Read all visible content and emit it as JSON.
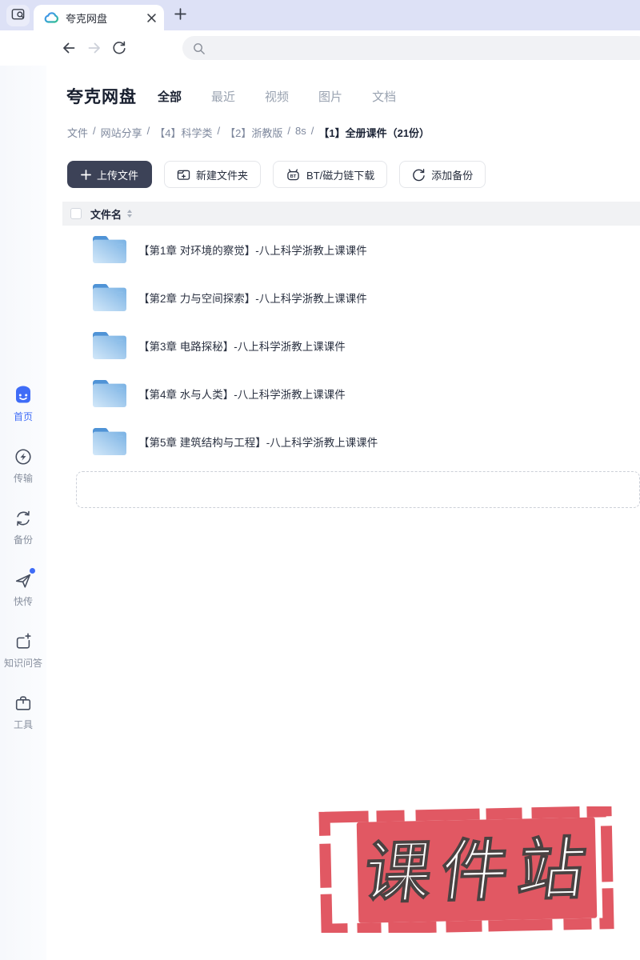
{
  "browser": {
    "tab_title": "夸克网盘",
    "icons": {
      "tab_search": "window-search-icon",
      "logo": "quark-cloud-logo-icon",
      "close": "close-icon",
      "new_tab": "plus-icon",
      "back": "arrow-left-icon",
      "forward": "arrow-right-icon",
      "refresh": "refresh-icon",
      "address_search": "search-icon"
    }
  },
  "header": {
    "app_title": "夸克网盘",
    "tabs": [
      {
        "label": "全部",
        "active": true
      },
      {
        "label": "最近",
        "active": false
      },
      {
        "label": "视频",
        "active": false
      },
      {
        "label": "图片",
        "active": false
      },
      {
        "label": "文档",
        "active": false
      }
    ]
  },
  "breadcrumb": {
    "separator": "/",
    "parts": [
      "文件",
      "网站分享",
      "【4】科学类",
      "【2】浙教版",
      "8s"
    ],
    "current": "【1】全册课件（21份）"
  },
  "toolbar": {
    "upload": "上传文件",
    "new_folder": "新建文件夹",
    "bt_download": "BT/磁力链下载",
    "add_backup": "添加备份",
    "icons": {
      "upload": "plus-icon",
      "new_folder": "folder-plus-icon",
      "bt_download": "bt-robot-icon",
      "add_backup": "sync-icon"
    }
  },
  "table": {
    "name_header": "文件名",
    "sort_icon": "sort-arrows-icon"
  },
  "files": [
    {
      "name": "【第1章 对环境的察觉】-八上科学浙教上课课件",
      "icon": "folder-icon"
    },
    {
      "name": "【第2章 力与空间探索】-八上科学浙教上课课件",
      "icon": "folder-icon"
    },
    {
      "name": "【第3章 电路探秘】-八上科学浙教上课课件",
      "icon": "folder-icon"
    },
    {
      "name": "【第4章 水与人类】-八上科学浙教上课课件",
      "icon": "folder-icon"
    },
    {
      "name": "【第5章 建筑结构与工程】-八上科学浙教上课课件",
      "icon": "folder-icon"
    }
  ],
  "sidebar": {
    "items": [
      {
        "label": "首页",
        "icon": "home-smile-icon",
        "active": true
      },
      {
        "label": "传输",
        "icon": "transfer-bolt-icon",
        "active": false
      },
      {
        "label": "备份",
        "icon": "backup-sync-icon",
        "active": false
      },
      {
        "label": "快传",
        "icon": "quick-send-icon",
        "active": false,
        "badge": true
      },
      {
        "label": "知识问答",
        "icon": "knowledge-qa-icon",
        "active": false
      },
      {
        "label": "工具",
        "icon": "toolbox-icon",
        "active": false
      }
    ]
  },
  "stamp": {
    "text": "课件站",
    "color": "#e15863"
  },
  "colors": {
    "tabbar_bg": "#dde1f6",
    "accent_blue": "#3f6cf7",
    "primary_button": "#3c4257",
    "folder_blue": "#7ab2e4",
    "header_bg": "#f1f2f4",
    "stamp_red": "#e15863"
  }
}
